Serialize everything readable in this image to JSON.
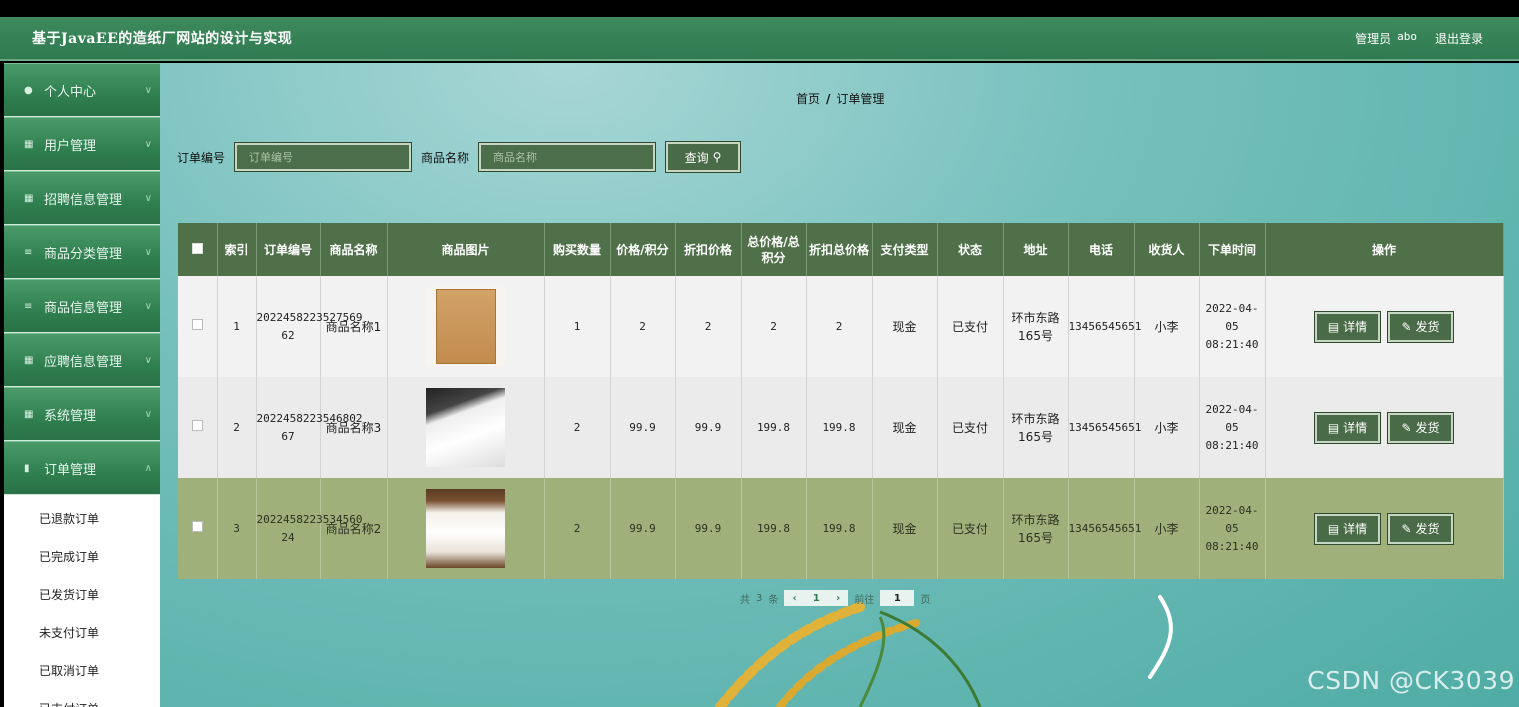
{
  "header": {
    "title": "基于JavaEE的造纸厂网站的设计与实现",
    "role": "管理员",
    "username": "abo",
    "logout": "退出登录"
  },
  "sidebar": {
    "items": [
      {
        "label": "个人中心",
        "icon": "person-icon"
      },
      {
        "label": "用户管理",
        "icon": "grid-icon"
      },
      {
        "label": "招聘信息管理",
        "icon": "grid-icon"
      },
      {
        "label": "商品分类管理",
        "icon": "list-icon"
      },
      {
        "label": "商品信息管理",
        "icon": "list-icon"
      },
      {
        "label": "应聘信息管理",
        "icon": "grid-icon"
      },
      {
        "label": "系统管理",
        "icon": "grid-icon"
      },
      {
        "label": "订单管理",
        "icon": "clipboard-icon"
      }
    ],
    "submenu": [
      "已退款订单",
      "已完成订单",
      "已发货订单",
      "未支付订单",
      "已取消订单",
      "已支付订单"
    ]
  },
  "breadcrumb": {
    "home": "首页",
    "sep": "/",
    "current": "订单管理"
  },
  "search": {
    "order_label": "订单编号",
    "order_placeholder": "订单编号",
    "product_label": "商品名称",
    "product_placeholder": "商品名称",
    "button": "查询"
  },
  "table": {
    "headers": [
      "索引",
      "订单编号",
      "商品名称",
      "商品图片",
      "购买数量",
      "价格/积分",
      "折扣价格",
      "总价格/总积分",
      "折扣总价格",
      "支付类型",
      "状态",
      "地址",
      "电话",
      "收货人",
      "下单时间",
      "操作"
    ],
    "rows": [
      {
        "index": "1",
        "order_no": "2022458223527569 62",
        "product": "商品名称1",
        "image": "kraft-folder",
        "qty": "1",
        "price": "2",
        "discount": "2",
        "total": "2",
        "discount_total": "2",
        "pay": "现金",
        "status": "已支付",
        "address": "环市东路165号",
        "phone": "13456545651",
        "receiver": "小李",
        "time": "2022-04-05 08:21:40"
      },
      {
        "index": "2",
        "order_no": "2022458223546802 67",
        "product": "商品名称3",
        "image": "white-paper",
        "qty": "2",
        "price": "99.9",
        "discount": "99.9",
        "total": "199.8",
        "discount_total": "199.8",
        "pay": "现金",
        "status": "已支付",
        "address": "环市东路165号",
        "phone": "13456545651",
        "receiver": "小李",
        "time": "2022-04-05 08:21:40"
      },
      {
        "index": "3",
        "order_no": "2022458223534560 24",
        "product": "商品名称2",
        "image": "paper-stack",
        "qty": "2",
        "price": "99.9",
        "discount": "99.9",
        "total": "199.8",
        "discount_total": "199.8",
        "pay": "现金",
        "status": "已支付",
        "address": "环市东路165号",
        "phone": "13456545651",
        "receiver": "小李",
        "time": "2022-04-05 08:21:40"
      }
    ],
    "detail_btn": "详情",
    "ship_btn": "发货"
  },
  "pager": {
    "total_prefix": "共",
    "total": "3",
    "total_suffix": "条",
    "current": "1",
    "goto": "前往",
    "goto_value": "1",
    "page_suffix": "页"
  },
  "watermark": "CSDN @CK3039",
  "colors": {
    "header": "#2f7a50",
    "table_header": "#4f7049",
    "highlight_row": "#9fb07a",
    "button": "#4a6b47"
  }
}
